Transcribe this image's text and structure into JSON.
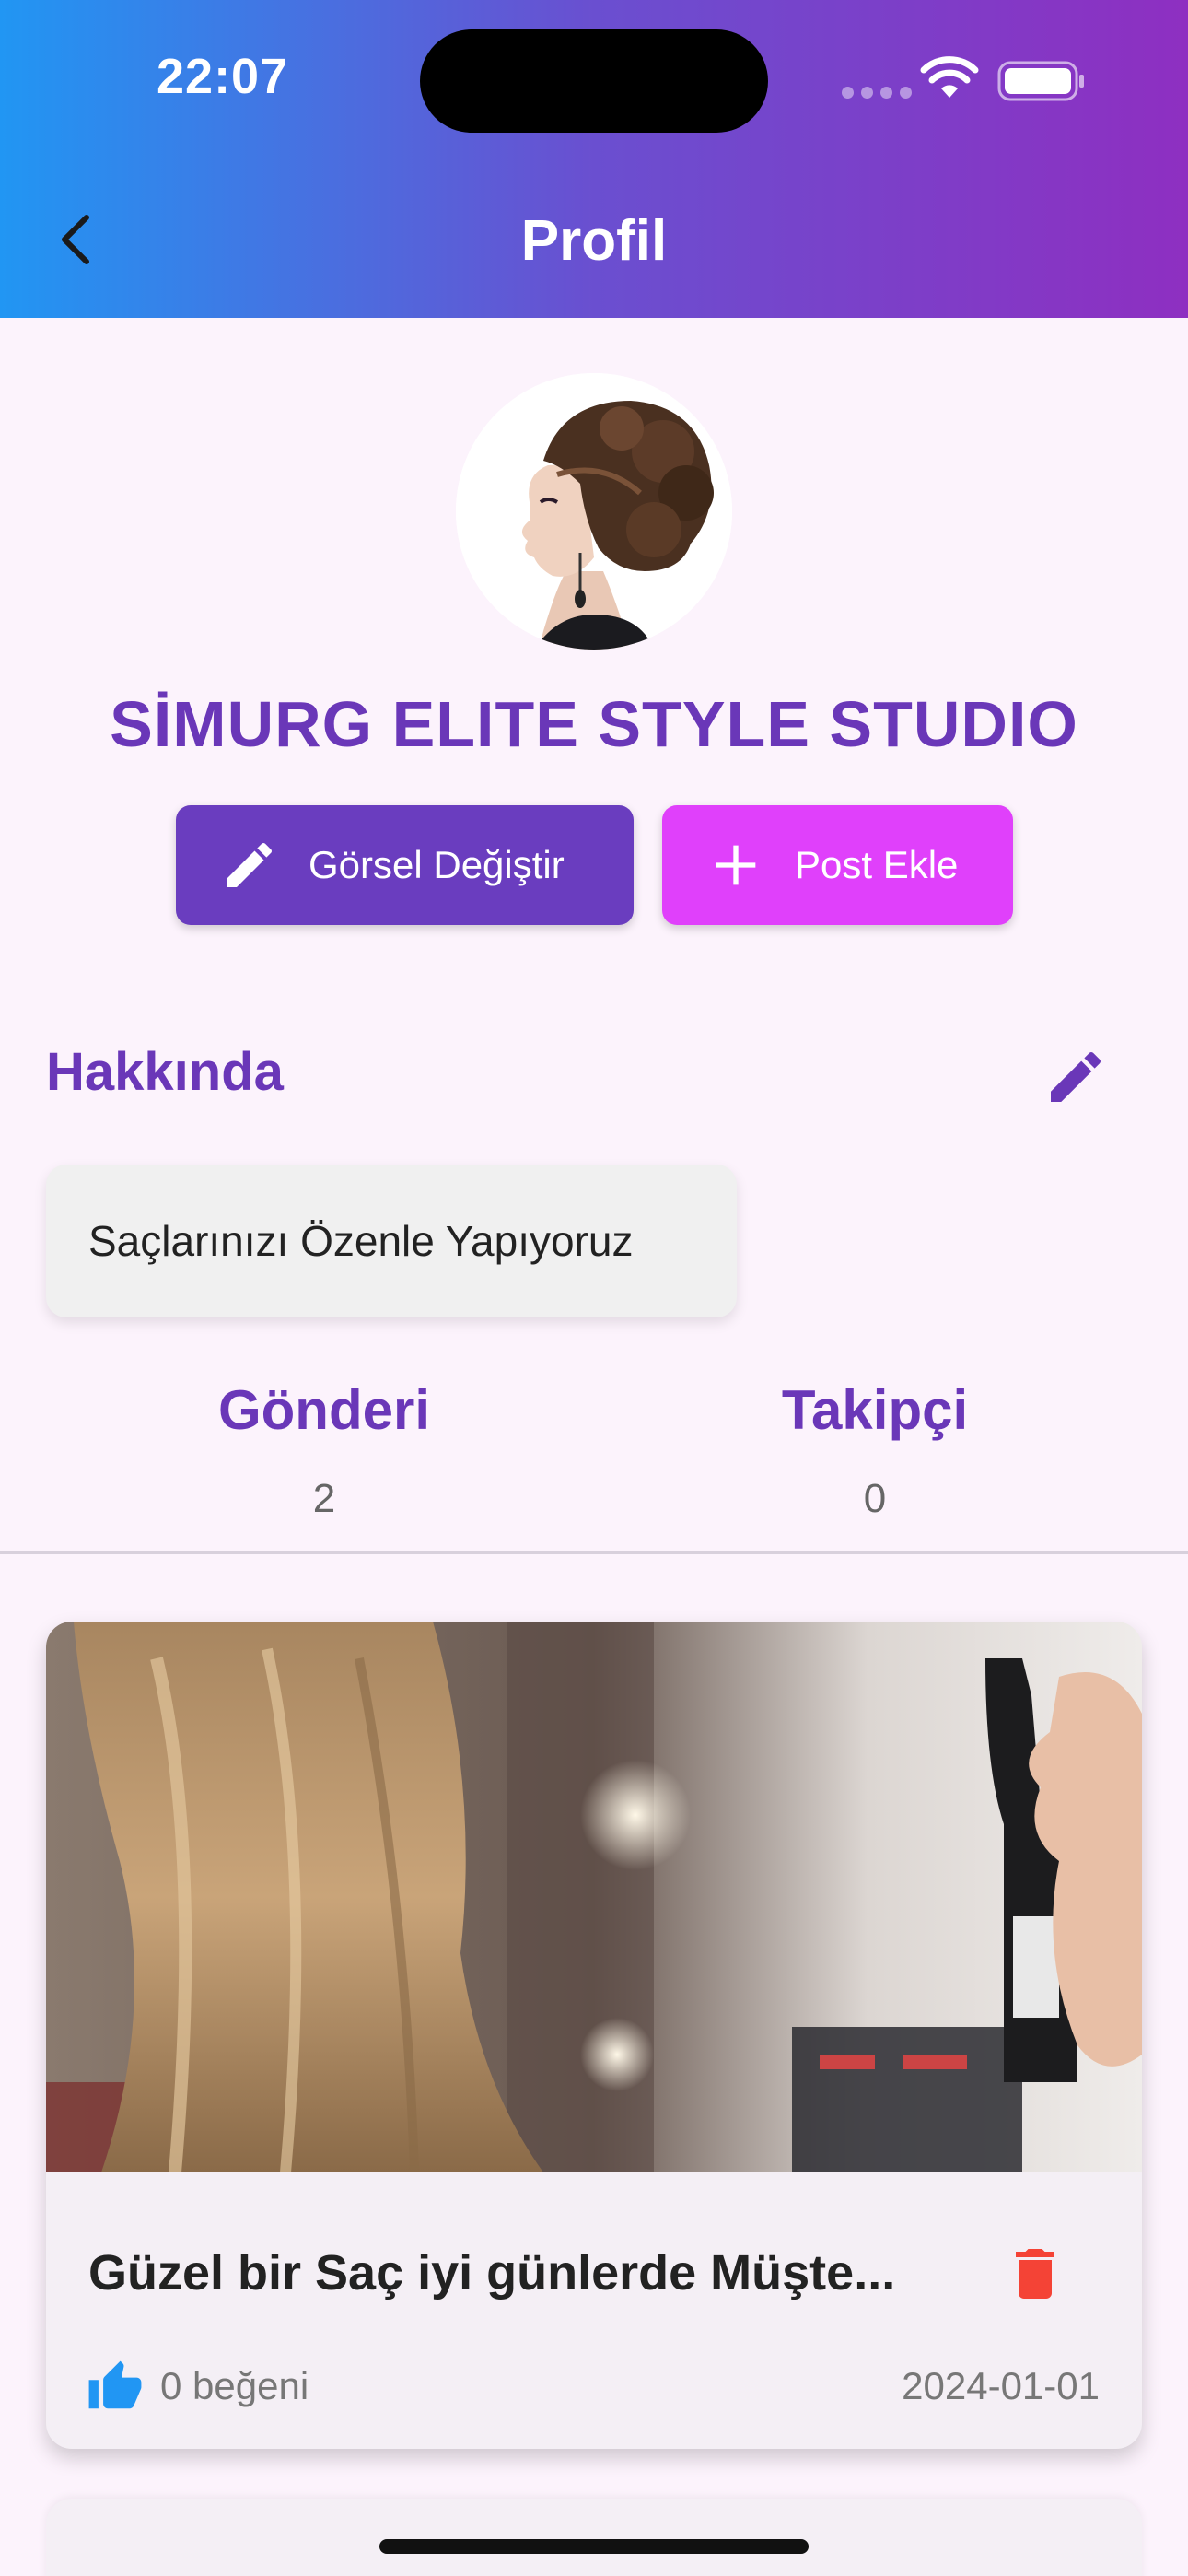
{
  "status_bar": {
    "time": "22:07"
  },
  "header": {
    "title": "Profil"
  },
  "profile": {
    "name": "SİMURG ELITE STYLE STUDIO",
    "change_image_label": "Görsel Değiştir",
    "add_post_label": "Post Ekle"
  },
  "about": {
    "title": "Hakkında",
    "text": "Saçlarınızı Özenle Yapıyoruz"
  },
  "stats": {
    "posts_label": "Gönderi",
    "posts_value": "2",
    "followers_label": "Takipçi",
    "followers_value": "0"
  },
  "posts": [
    {
      "title": "Güzel bir Saç iyi günlerde Müşte...",
      "likes": "0 beğeni",
      "date": "2024-01-01"
    }
  ],
  "colors": {
    "accent_purple": "#6a37b8",
    "button_purple": "#6a3dbf",
    "button_pink": "#e040fb",
    "delete_red": "#f44336",
    "like_blue": "#2196f3"
  }
}
